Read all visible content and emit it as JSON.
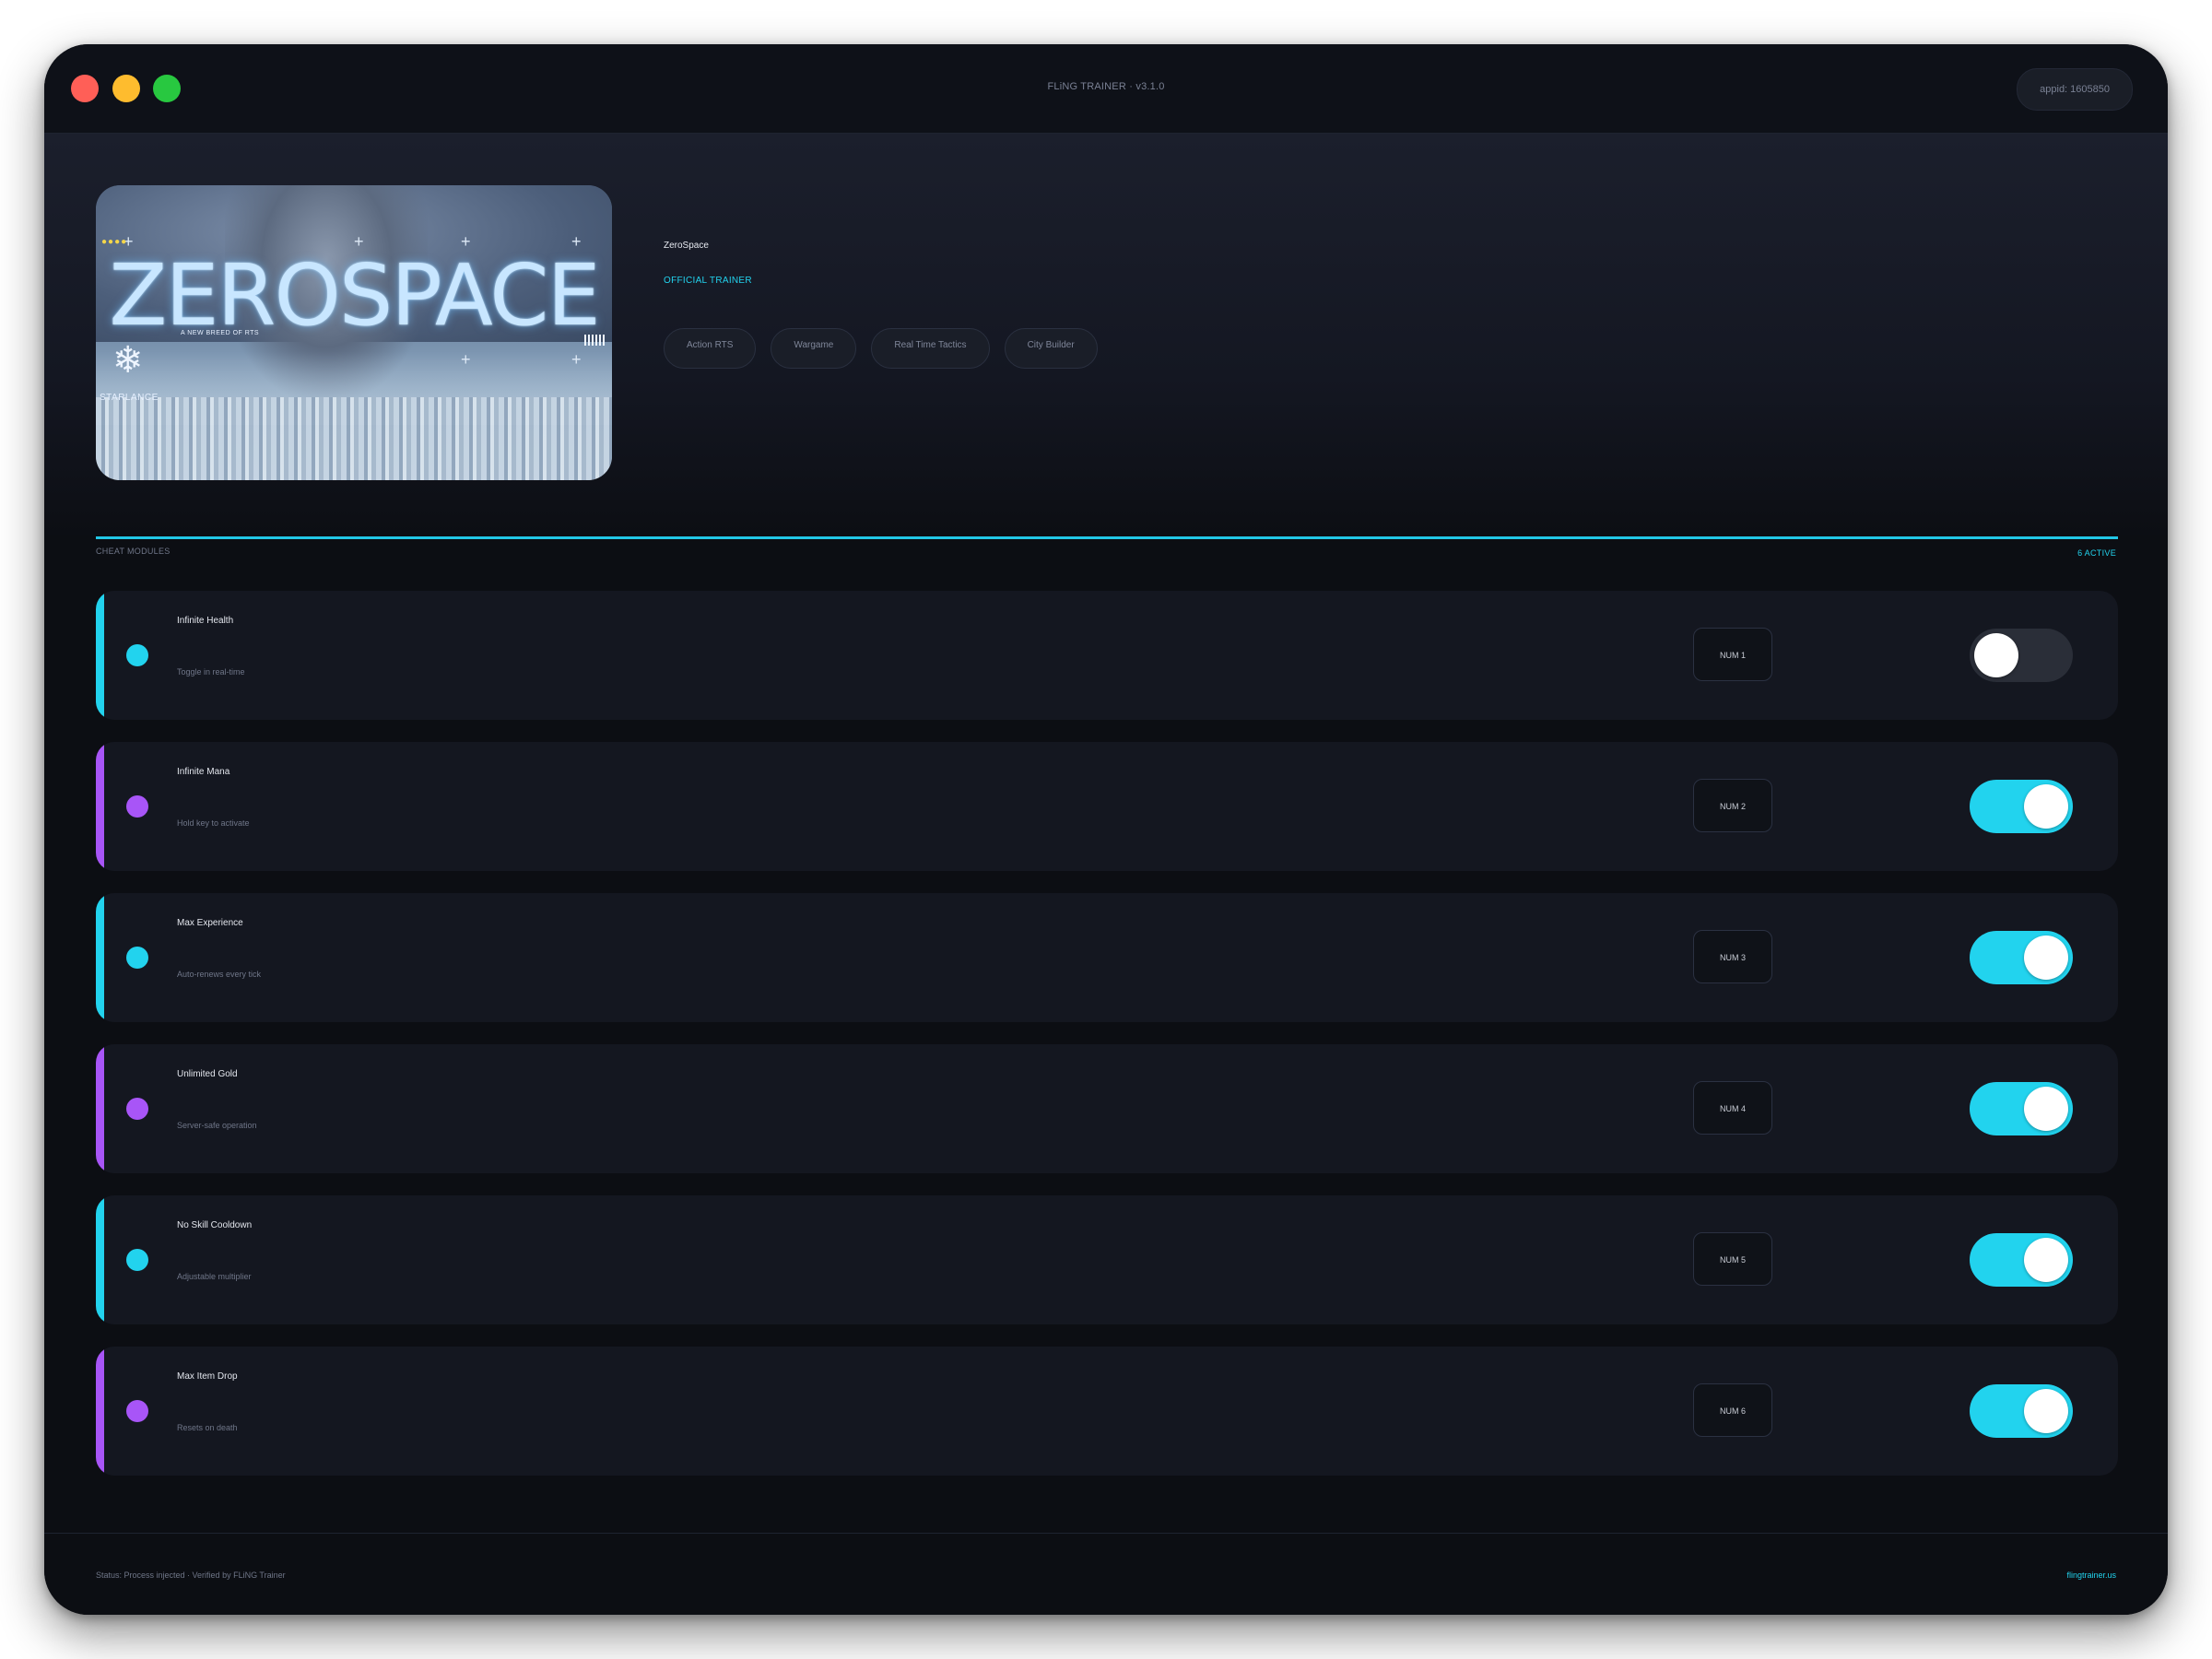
{
  "window": {
    "title": "FLiNG TRAINER · v3.1.0",
    "appid": "appid: 1605850"
  },
  "game": {
    "title": "ZeroSpace",
    "badge": "OFFICIAL TRAINER",
    "cover": {
      "logo_text": "ZEROSPACE",
      "tagline": "A NEW BREED OF RTS",
      "studio": "STARLANCE"
    },
    "tags": [
      "Action RTS",
      "Wargame",
      "Real Time Tactics",
      "City Builder"
    ]
  },
  "section": {
    "label": "CHEAT MODULES",
    "count": "6 ACTIVE"
  },
  "colors": {
    "accent_cyan": "#22d3ee",
    "accent_purple": "#a855f7",
    "toggle_off": "#2a2e38"
  },
  "cheats": [
    {
      "name": "Infinite Health",
      "desc": "Toggle in real-time",
      "hotkey": "NUM 1",
      "enabled": false,
      "accent": "#22d3ee"
    },
    {
      "name": "Infinite Mana",
      "desc": "Hold key to activate",
      "hotkey": "NUM 2",
      "enabled": true,
      "accent": "#a855f7"
    },
    {
      "name": "Max Experience",
      "desc": "Auto-renews every tick",
      "hotkey": "NUM 3",
      "enabled": true,
      "accent": "#22d3ee"
    },
    {
      "name": "Unlimited Gold",
      "desc": "Server-safe operation",
      "hotkey": "NUM 4",
      "enabled": true,
      "accent": "#a855f7"
    },
    {
      "name": "No Skill Cooldown",
      "desc": "Adjustable multiplier",
      "hotkey": "NUM 5",
      "enabled": true,
      "accent": "#22d3ee"
    },
    {
      "name": "Max Item Drop",
      "desc": "Resets on death",
      "hotkey": "NUM 6",
      "enabled": true,
      "accent": "#a855f7"
    }
  ],
  "footer": {
    "status": "Status: Process injected · Verified by FLiNG Trainer",
    "link": "flingtrainer.us"
  }
}
